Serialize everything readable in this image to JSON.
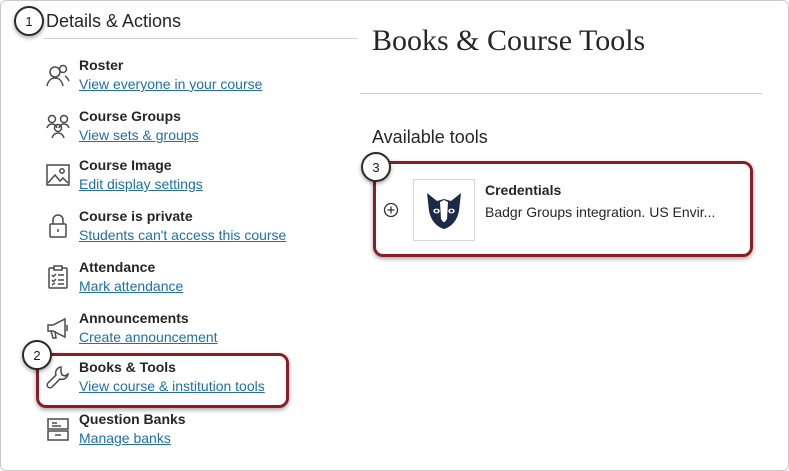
{
  "sidebar": {
    "title": "Details & Actions",
    "items": [
      {
        "title": "Roster",
        "link": "View everyone in your course",
        "icon": "roster-icon"
      },
      {
        "title": "Course Groups",
        "link": "View sets & groups",
        "icon": "groups-icon"
      },
      {
        "title": "Course Image",
        "link": "Edit display settings",
        "icon": "image-icon"
      },
      {
        "title": "Course is private",
        "link": "Students can't access this course",
        "icon": "lock-icon"
      },
      {
        "title": "Attendance",
        "link": "Mark attendance",
        "icon": "attendance-icon"
      },
      {
        "title": "Announcements",
        "link": "Create announcement",
        "icon": "megaphone-icon"
      },
      {
        "title": "Books & Tools",
        "link": "View course & institution tools",
        "icon": "wrench-icon"
      },
      {
        "title": "Question Banks",
        "link": "Manage banks",
        "icon": "question-bank-icon"
      }
    ]
  },
  "main": {
    "title": "Books & Course Tools",
    "section_title": "Available tools",
    "tools": [
      {
        "name": "Credentials",
        "description": "Badgr Groups integration. US Envir...",
        "logo": "badger-logo-icon",
        "action_icon": "add-circle-icon"
      }
    ]
  },
  "callouts": {
    "step1": "1",
    "step2": "2",
    "step3": "3"
  },
  "colors": {
    "link": "#1f6fa8",
    "callout_border": "#8c1d26",
    "logo_navy": "#1c2a4a"
  }
}
